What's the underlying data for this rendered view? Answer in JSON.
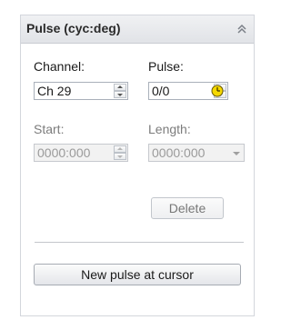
{
  "panel": {
    "title": "Pulse (cyc:deg)",
    "collapse_icon": "double-chevron-up-icon"
  },
  "fields": {
    "channel_label": "Channel:",
    "channel_value": "Ch 29",
    "pulse_label": "Pulse:",
    "pulse_value": "0/0",
    "start_label": "Start:",
    "start_value": "0000:000",
    "length_label": "Length:",
    "length_value": "0000:000"
  },
  "buttons": {
    "delete_label": "Delete",
    "new_pulse_label": "New pulse at cursor"
  },
  "icons": {
    "pulse_timer": "clock-icon"
  },
  "colors": {
    "clock_fill": "#f5d800"
  }
}
